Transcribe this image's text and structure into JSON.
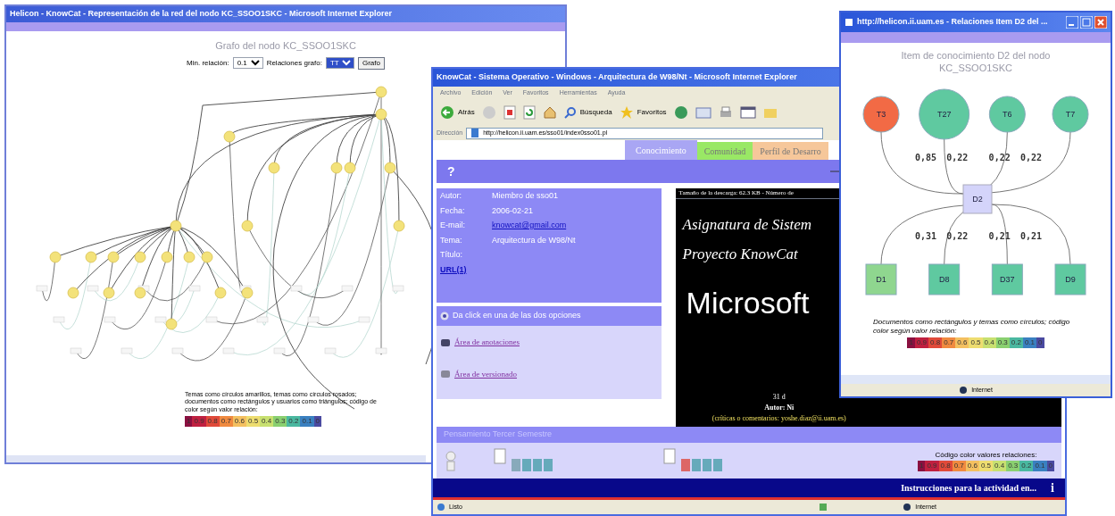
{
  "graph_window": {
    "title": "Helicon - KnowCat - Representación de la red del nodo KC_SSOO1SKC - Microsoft Internet Explorer",
    "heading": "Grafo del nodo KC_SSOO1SKC",
    "min_label": "Min. relación:",
    "min_value": "0.1",
    "rel_label": "Relaciones grafo:",
    "rel_value": "TT",
    "button": "Grafo",
    "legend_text": "Temas como círculos amarillos, temas como círculos rosados; documentos como rectángulos y usuarios como triángulos; código de color según valor relación:",
    "legend": [
      "1",
      "0.9",
      "0.8",
      "0.7",
      "0.6",
      "0.5",
      "0.4",
      "0.3",
      "0.2",
      "0.1",
      "0"
    ]
  },
  "main_window": {
    "title": "KnowCat - Sistema Operativo - Windows - Arquitectura de W98/Nt - Microsoft Internet Explorer",
    "menu": [
      "Archivo",
      "Edición",
      "Ver",
      "Favoritos",
      "Herramientas",
      "Ayuda"
    ],
    "back": "Atrás",
    "search": "Búsqueda",
    "favorites": "Favoritos",
    "address_label": "Dirección",
    "url": "http://helicon.ii.uam.es/sso01/index0sso01.pl",
    "tabs": [
      {
        "label": "Conocimiento",
        "selected": true,
        "color": "#a9a6f4"
      },
      {
        "label": "Comunidad",
        "selected": false,
        "color": "#99e865"
      },
      {
        "label": "Perfil de Desarro",
        "selected": false,
        "color": "#f6c79a"
      }
    ],
    "help": "?",
    "fields": [
      {
        "label": "Autor:",
        "value": "Miembro de sso01",
        "kind": "text"
      },
      {
        "label": "Fecha:",
        "value": "2006-02-21",
        "kind": "text"
      },
      {
        "label": "E-mail:",
        "value": "knowcat@gmail.com",
        "kind": "link"
      },
      {
        "label": "Tema:",
        "value": "Arquitectura de W98/Nt",
        "kind": "text"
      },
      {
        "label": "Título:",
        "kind": "text"
      }
    ],
    "url_link": "URL(1)",
    "options_bar": "Da click en una de las dos opciones",
    "links": [
      "Área de anotaciones",
      "Área de versionado"
    ],
    "preview": {
      "header": "Tamaño de la descarga: 62.3 KB - Número de",
      "lines": [
        "Asignatura de Sistem",
        "Proyecto KnowCat",
        "Microsoft"
      ],
      "footer_date": "31 d",
      "footer_author": "Autor: Ni",
      "footer_note": "(críticas o comentarios: yoshe.diaz@ii.uam.es)"
    },
    "bottom_bar": "Pensamiento Tercer Semestre",
    "legend_caption": "Código color valores relaciones:",
    "legend": [
      "1",
      "0.9",
      "0.8",
      "0.7",
      "0.6",
      "0.5",
      "0.4",
      "0.3",
      "0.2",
      "0.1",
      "0"
    ],
    "instructions": "Instrucciones para la actividad en...",
    "info": "i",
    "status": "Listo",
    "zone": "Internet"
  },
  "relations_window": {
    "title": "http://helicon.ii.uam.es - Relaciones Item D2 del ...",
    "heading": "Item de conocimiento D2 del nodo KC_SSOO1SKC",
    "center": "D2",
    "topics": [
      {
        "label": "T3",
        "weight": "0,85",
        "color": "#f26a45"
      },
      {
        "label": "T27",
        "weight": "0,22",
        "color": "#5fc9a0"
      },
      {
        "label": "T6",
        "weight": "0,22",
        "color": "#5fc9a0"
      },
      {
        "label": "T7",
        "weight": "0,22",
        "color": "#5fc9a0"
      }
    ],
    "documents": [
      {
        "label": "D1",
        "weight": "0,31",
        "color": "#8fd68f"
      },
      {
        "label": "D8",
        "weight": "0,22",
        "color": "#5fc9a0"
      },
      {
        "label": "D37",
        "weight": "0,21",
        "color": "#5fc9a0"
      },
      {
        "label": "D9",
        "weight": "0,21",
        "color": "#5fc9a0"
      }
    ],
    "legend_text": "Documentos como rectángulos y temas como círculos; código color según valor relación:",
    "legend": [
      "1",
      "0.9",
      "0.8",
      "0.7",
      "0.6",
      "0.5",
      "0.4",
      "0.3",
      "0.2",
      "0.1",
      "0"
    ],
    "zone": "Internet"
  }
}
